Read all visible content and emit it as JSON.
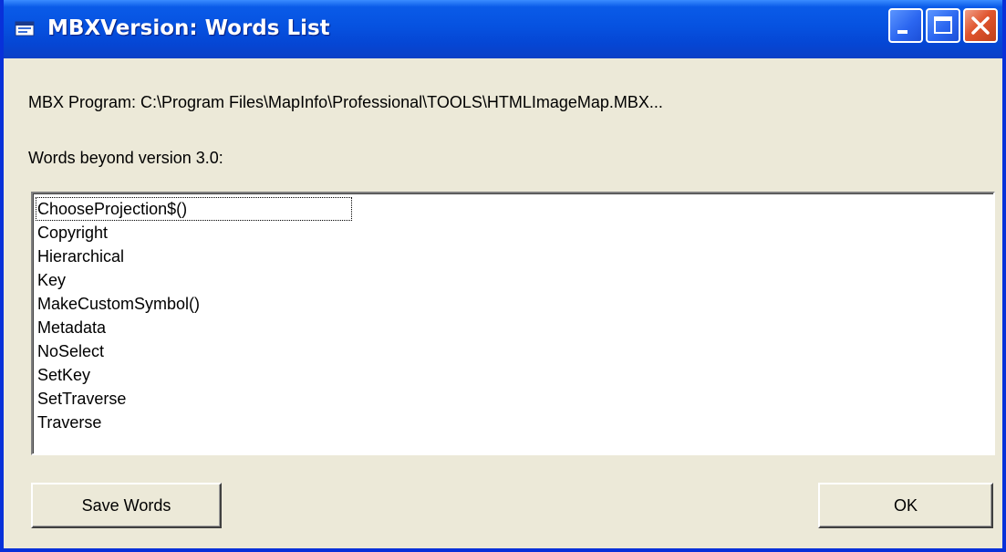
{
  "window": {
    "title": "MBXVersion: Words List",
    "accent_color": "#0a5be8",
    "close_color": "#e0552e",
    "icons": {
      "app": "app-window-icon",
      "minimize": "minimize-icon",
      "maximize": "maximize-icon",
      "close": "close-icon"
    }
  },
  "content": {
    "program_label": "MBX Program: C:\\Program Files\\MapInfo\\Professional\\TOOLS\\HTMLImageMap.MBX...",
    "words_label": "Words beyond version 3.0:",
    "words": [
      "ChooseProjection$()",
      "Copyright",
      "Hierarchical",
      "Key",
      "MakeCustomSymbol()",
      "Metadata",
      "NoSelect",
      "SetKey",
      "SetTraverse",
      "Traverse"
    ]
  },
  "buttons": {
    "save": "Save Words",
    "ok": "OK"
  }
}
